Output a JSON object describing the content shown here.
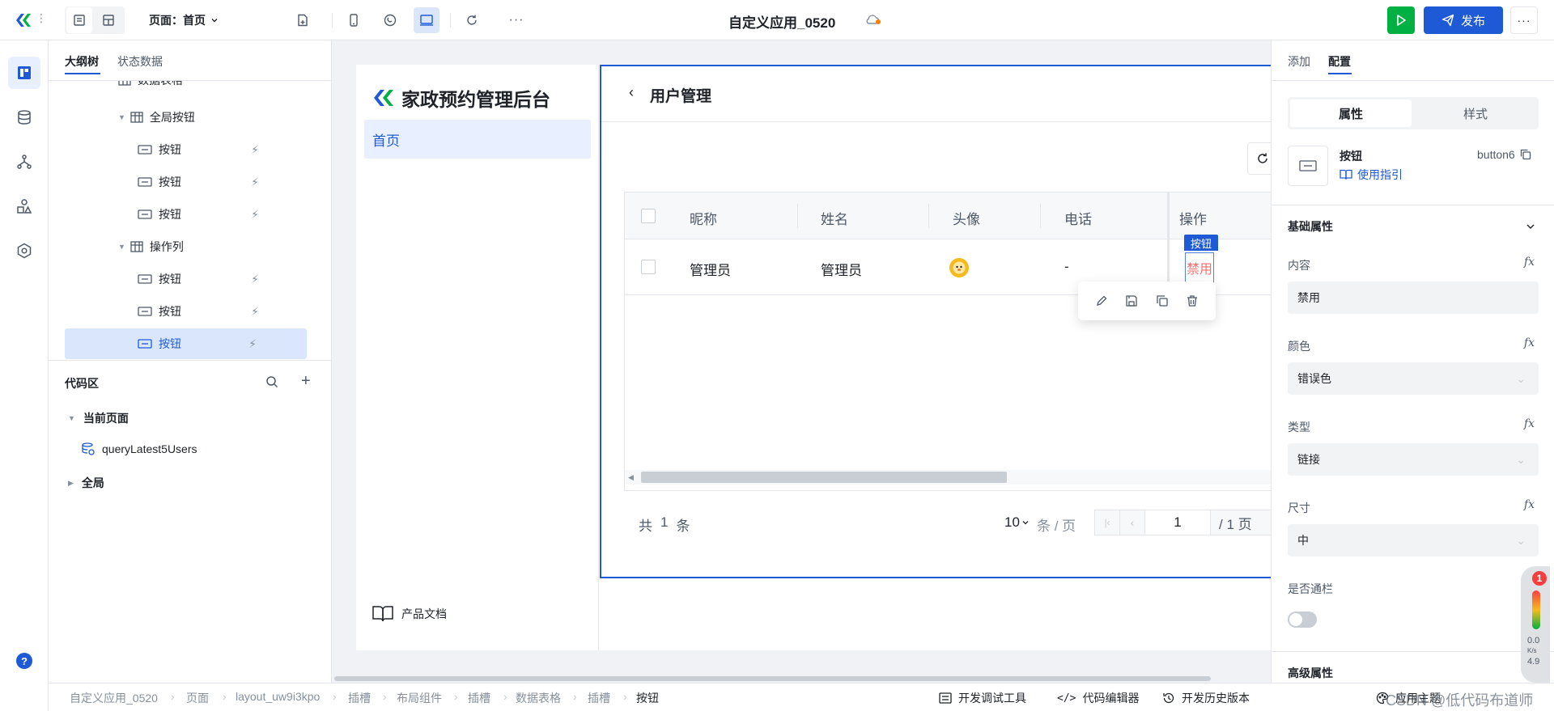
{
  "topbar": {
    "page_selector": "页面：首页",
    "app_title": "自定义应用_0520",
    "publish_label": "发布",
    "more": "···"
  },
  "left_panel": {
    "tabs": [
      "大纲树",
      "状态数据"
    ],
    "tree": [
      {
        "label": "数据表格",
        "icon": "table-icon"
      },
      {
        "label": "全局按钮",
        "icon": "table-icon"
      },
      {
        "label": "按钮",
        "icon": "button-icon"
      },
      {
        "label": "按钮",
        "icon": "button-icon"
      },
      {
        "label": "按钮",
        "icon": "button-icon"
      },
      {
        "label": "操作列",
        "icon": "table-icon"
      },
      {
        "label": "按钮",
        "icon": "button-icon"
      },
      {
        "label": "按钮",
        "icon": "button-icon"
      },
      {
        "label": "按钮",
        "icon": "button-icon",
        "selected": true
      }
    ],
    "code_area": {
      "title": "代码区",
      "current_page": "当前页面",
      "query": "queryLatest5Users",
      "global": "全局"
    }
  },
  "app": {
    "logo_title": "家政预约管理后台",
    "menu_home": "首页",
    "product_docs": "产品文档",
    "page_title": "用户管理",
    "table": {
      "columns": [
        "昵称",
        "姓名",
        "头像",
        "电话",
        "操作"
      ],
      "rows": [
        {
          "nickname": "管理员",
          "name": "管理员",
          "avatar": "lion-avatar",
          "phone": "-",
          "action": "禁用"
        }
      ]
    },
    "button_tag": "按钮",
    "pagination": {
      "total_prefix": "共",
      "total": "1",
      "total_suffix": "条",
      "page_size": "10",
      "page_size_unit": "条 / 页",
      "current_page": "1",
      "total_pages": "/ 1 页"
    }
  },
  "right_panel": {
    "tabs": [
      "添加",
      "配置"
    ],
    "segments": [
      "属性",
      "样式"
    ],
    "component": {
      "name": "按钮",
      "id": "button6",
      "guide": "使用指引"
    },
    "section_basic": "基础属性",
    "fields": [
      {
        "label": "内容",
        "value": "禁用"
      },
      {
        "label": "颜色",
        "value": "错误色"
      },
      {
        "label": "类型",
        "value": "链接"
      },
      {
        "label": "尺寸",
        "value": "中"
      }
    ],
    "toggle_label": "是否通栏",
    "section_advanced": "高级属性",
    "perf": {
      "badge": "1",
      "speed": "0.0",
      "unit": "K/s",
      "value": "4.9"
    }
  },
  "bottombar": {
    "breadcrumb": [
      "自定义应用_0520",
      "页面",
      "layout_uw9i3kpo",
      "插槽",
      "布局组件",
      "插槽",
      "数据表格",
      "插槽",
      "按钮"
    ],
    "tools": [
      "开发调试工具",
      "代码编辑器",
      "开发历史版本",
      "应用主题"
    ],
    "watermark": "CSDN @低代码布道师"
  },
  "colors": {
    "primary": "#1e5ad6",
    "run": "#00b042",
    "error": "#f53f3f"
  }
}
